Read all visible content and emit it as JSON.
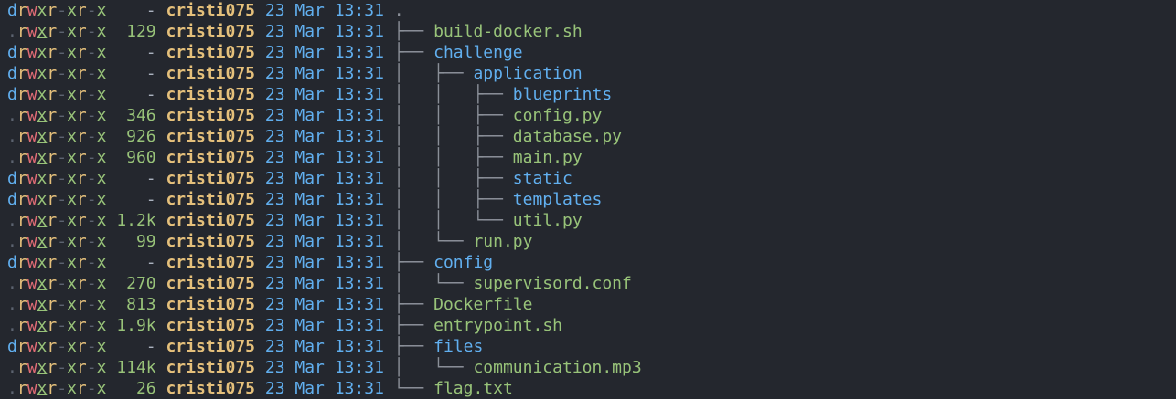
{
  "colors": {
    "background": "#24272e",
    "directory": "#61afef",
    "file": "#98c379",
    "perm_r": "#e5c07b",
    "perm_w": "#e06c75",
    "perm_x": "#98c379",
    "dash": "#5c6370",
    "user": "#e5c07b",
    "date": "#61afef",
    "tree_lines": "#8a8f98"
  },
  "entries": [
    {
      "perm": "drwxr-xr-x",
      "size": "-",
      "user": "cristi075",
      "date": "23 Mar 13:31",
      "tree": "",
      "name": ".",
      "type": "root"
    },
    {
      "perm": ".rwxr-xr-x",
      "size": "129",
      "user": "cristi075",
      "date": "23 Mar 13:31",
      "tree": "├── ",
      "name": "build-docker.sh",
      "type": "file"
    },
    {
      "perm": "drwxr-xr-x",
      "size": "-",
      "user": "cristi075",
      "date": "23 Mar 13:31",
      "tree": "├── ",
      "name": "challenge",
      "type": "dir"
    },
    {
      "perm": "drwxr-xr-x",
      "size": "-",
      "user": "cristi075",
      "date": "23 Mar 13:31",
      "tree": "│   ├── ",
      "name": "application",
      "type": "dir"
    },
    {
      "perm": "drwxr-xr-x",
      "size": "-",
      "user": "cristi075",
      "date": "23 Mar 13:31",
      "tree": "│   │   ├── ",
      "name": "blueprints",
      "type": "dir"
    },
    {
      "perm": ".rwxr-xr-x",
      "size": "346",
      "user": "cristi075",
      "date": "23 Mar 13:31",
      "tree": "│   │   ├── ",
      "name": "config.py",
      "type": "file"
    },
    {
      "perm": ".rwxr-xr-x",
      "size": "926",
      "user": "cristi075",
      "date": "23 Mar 13:31",
      "tree": "│   │   ├── ",
      "name": "database.py",
      "type": "file"
    },
    {
      "perm": ".rwxr-xr-x",
      "size": "960",
      "user": "cristi075",
      "date": "23 Mar 13:31",
      "tree": "│   │   ├── ",
      "name": "main.py",
      "type": "file"
    },
    {
      "perm": "drwxr-xr-x",
      "size": "-",
      "user": "cristi075",
      "date": "23 Mar 13:31",
      "tree": "│   │   ├── ",
      "name": "static",
      "type": "dir"
    },
    {
      "perm": "drwxr-xr-x",
      "size": "-",
      "user": "cristi075",
      "date": "23 Mar 13:31",
      "tree": "│   │   ├── ",
      "name": "templates",
      "type": "dir"
    },
    {
      "perm": ".rwxr-xr-x",
      "size": "1.2k",
      "user": "cristi075",
      "date": "23 Mar 13:31",
      "tree": "│   │   └── ",
      "name": "util.py",
      "type": "file"
    },
    {
      "perm": ".rwxr-xr-x",
      "size": "99",
      "user": "cristi075",
      "date": "23 Mar 13:31",
      "tree": "│   └── ",
      "name": "run.py",
      "type": "file"
    },
    {
      "perm": "drwxr-xr-x",
      "size": "-",
      "user": "cristi075",
      "date": "23 Mar 13:31",
      "tree": "├── ",
      "name": "config",
      "type": "dir"
    },
    {
      "perm": ".rwxr-xr-x",
      "size": "270",
      "user": "cristi075",
      "date": "23 Mar 13:31",
      "tree": "│   └── ",
      "name": "supervisord.conf",
      "type": "file"
    },
    {
      "perm": ".rwxr-xr-x",
      "size": "813",
      "user": "cristi075",
      "date": "23 Mar 13:31",
      "tree": "├── ",
      "name": "Dockerfile",
      "type": "file"
    },
    {
      "perm": ".rwxr-xr-x",
      "size": "1.9k",
      "user": "cristi075",
      "date": "23 Mar 13:31",
      "tree": "├── ",
      "name": "entrypoint.sh",
      "type": "file"
    },
    {
      "perm": "drwxr-xr-x",
      "size": "-",
      "user": "cristi075",
      "date": "23 Mar 13:31",
      "tree": "├── ",
      "name": "files",
      "type": "dir"
    },
    {
      "perm": ".rwxr-xr-x",
      "size": "114k",
      "user": "cristi075",
      "date": "23 Mar 13:31",
      "tree": "│   └── ",
      "name": "communication.mp3",
      "type": "file"
    },
    {
      "perm": ".rwxr-xr-x",
      "size": "26",
      "user": "cristi075",
      "date": "23 Mar 13:31",
      "tree": "└── ",
      "name": "flag.txt",
      "type": "file"
    }
  ]
}
